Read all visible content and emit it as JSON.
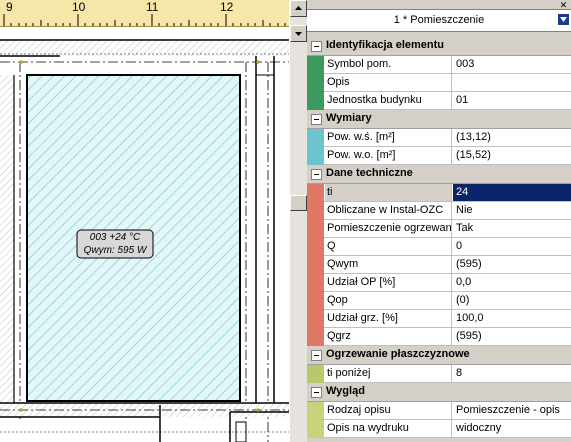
{
  "ruler": {
    "labels": [
      "9",
      "10",
      "11",
      "12"
    ]
  },
  "room_label": {
    "line1": "003  +24 °C",
    "line2": "Qwym: 595 W"
  },
  "panel": {
    "title": "1 * Pomieszczenie",
    "close_glyph": "✕",
    "sections": [
      {
        "label": "Identyfikacja elementu",
        "color": "#2e8b57",
        "rows": [
          {
            "name": "Symbol pom.",
            "value": "003"
          },
          {
            "name": "Opis",
            "value": ""
          },
          {
            "name": "Jednostka budynku",
            "value": "01"
          }
        ]
      },
      {
        "label": "Wymiary",
        "color": "#5fb8c8",
        "rows": [
          {
            "name": "Pow. w.ś. [m²]",
            "value": "(13,12)"
          },
          {
            "name": "Pow. w.o. [m²]",
            "value": "(15,52)"
          }
        ]
      },
      {
        "label": "Dane techniczne",
        "color": "#e07868",
        "rows": [
          {
            "name": "ti",
            "value": "24",
            "selected": true
          },
          {
            "name": "Obliczane w Instal-OZC",
            "value": "Nie"
          },
          {
            "name": "Pomieszczenie ogrzewane",
            "value": "Tak"
          },
          {
            "name": "Q",
            "value": "0"
          },
          {
            "name": "Qwym",
            "value": "(595)"
          },
          {
            "name": "Udział OP [%]",
            "value": "0,0"
          },
          {
            "name": "Qop",
            "value": "(0)"
          },
          {
            "name": "Udział grz. [%]",
            "value": "100,0"
          },
          {
            "name": "Qgrz",
            "value": "(595)"
          }
        ]
      },
      {
        "label": "Ogrzewanie płaszczyznowe",
        "color": "#b7c96a",
        "rows": [
          {
            "name": "ti poniżej",
            "value": "8"
          }
        ]
      },
      {
        "label": "Wygląd",
        "color": "#c9d27a",
        "rows": [
          {
            "name": "Rodzaj opisu",
            "value": "Pomieszczenie - opis"
          },
          {
            "name": "Opis na wydruku",
            "value": "widoczny"
          }
        ]
      }
    ]
  }
}
